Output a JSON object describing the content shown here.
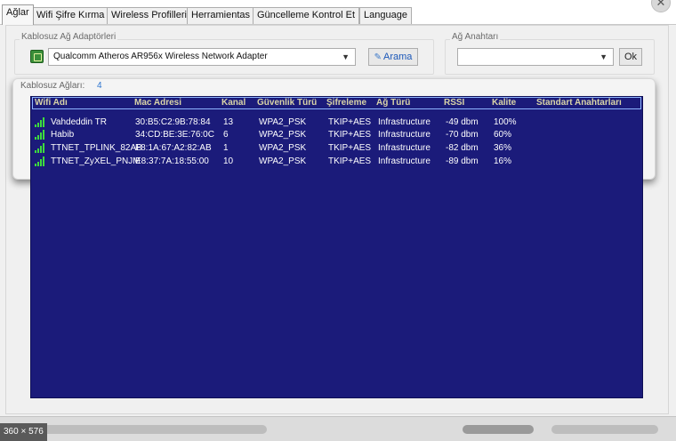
{
  "tabs": [
    {
      "label": "Ağlar",
      "active": true
    },
    {
      "label": "Wifi Şifre Kırma",
      "active": false
    },
    {
      "label": "Wireless Profilleri",
      "active": false
    },
    {
      "label": "Herramientas",
      "active": false
    },
    {
      "label": "Güncelleme Kontrol Et",
      "active": false
    },
    {
      "label": "Language",
      "active": false
    }
  ],
  "close_glyph": "✕",
  "adapters": {
    "label": "Kablosuz Ağ Adaptörleri",
    "selected": "Qualcomm Atheros AR956x Wireless Network Adapter",
    "search_label": "Arama"
  },
  "network_key": {
    "label": "Ağ Anahtarı",
    "value": "",
    "ok_label": "Ok"
  },
  "networks": {
    "label": "Kablosuz Ağları:",
    "count": "4",
    "columns": [
      "Wifi Adı",
      "Mac Adresi",
      "Kanal",
      "Güvenlik Türü",
      "Şifreleme",
      "Ağ Türü",
      "RSSI",
      "Kalite",
      "Standart Anahtarları"
    ],
    "rows": [
      {
        "name": "Vahdeddin TR",
        "mac": "30:B5:C2:9B:78:84",
        "channel": "13",
        "security": "WPA2_PSK",
        "encryption": "TKIP+AES",
        "type": "Infrastructure",
        "rssi": "-49 dbm",
        "quality": "100%",
        "signal_bars": 4
      },
      {
        "name": "Habib",
        "mac": "34:CD:BE:3E:76:0C",
        "channel": "6",
        "security": "WPA2_PSK",
        "encryption": "TKIP+AES",
        "type": "Infrastructure",
        "rssi": "-70 dbm",
        "quality": "60%",
        "signal_bars": 4
      },
      {
        "name": "TTNET_TPLINK_82AB",
        "mac": "F8:1A:67:A2:82:AB",
        "channel": "1",
        "security": "WPA2_PSK",
        "encryption": "TKIP+AES",
        "type": "Infrastructure",
        "rssi": "-82 dbm",
        "quality": "36%",
        "signal_bars": 4
      },
      {
        "name": "TTNET_ZyXEL_PNJM",
        "mac": "E8:37:7A:18:55:00",
        "channel": "10",
        "security": "WPA2_PSK",
        "encryption": "TKIP+AES",
        "type": "Infrastructure",
        "rssi": "-89 dbm",
        "quality": "16%",
        "signal_bars": 4
      }
    ]
  },
  "dimension_badge": "360 × 576",
  "colors": {
    "list_background": "#1b1b7a",
    "header_text": "#d9d4a8",
    "signal_green": "#3ddc3d",
    "count_blue": "#2e76d0"
  }
}
